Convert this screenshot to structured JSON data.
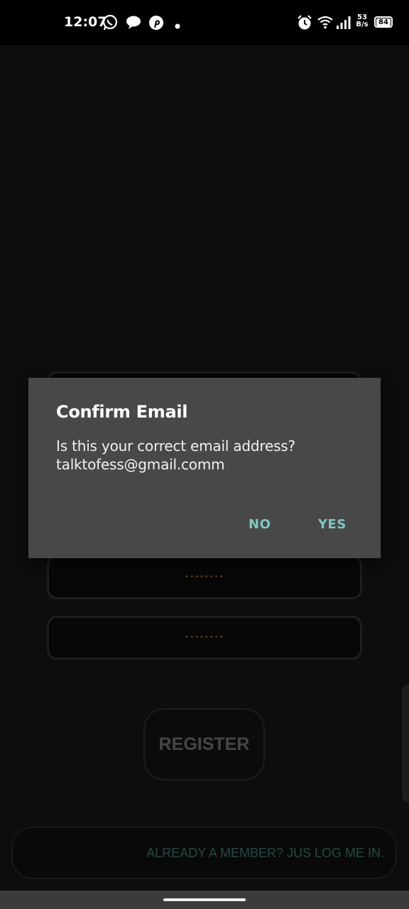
{
  "status_bar": {
    "time": "12:07",
    "net_speed_value": "53",
    "net_speed_unit": "B/s",
    "battery": "84",
    "icons": [
      "whatsapp-icon",
      "chat-bubble-icon",
      "pinterest-icon",
      "dot-icon",
      "alarm-icon",
      "wifi-icon",
      "signal-icon",
      "battery-icon"
    ]
  },
  "form": {
    "password_mask": "••••••••",
    "confirm_password_mask": "••••••••",
    "register_label": "REGISTER",
    "login_link": "ALREADY A MEMBER? JUS LOG ME IN."
  },
  "dialog": {
    "title": "Confirm Email",
    "message_line1": "Is this your correct email address?",
    "message_line2": "talktofess@gmail.comm",
    "no_label": "NO",
    "yes_label": "YES"
  },
  "colors": {
    "accent": "#7fc8c2",
    "dialog_bg": "#484848",
    "link": "#3f6e68",
    "mask": "#9b5a20"
  }
}
